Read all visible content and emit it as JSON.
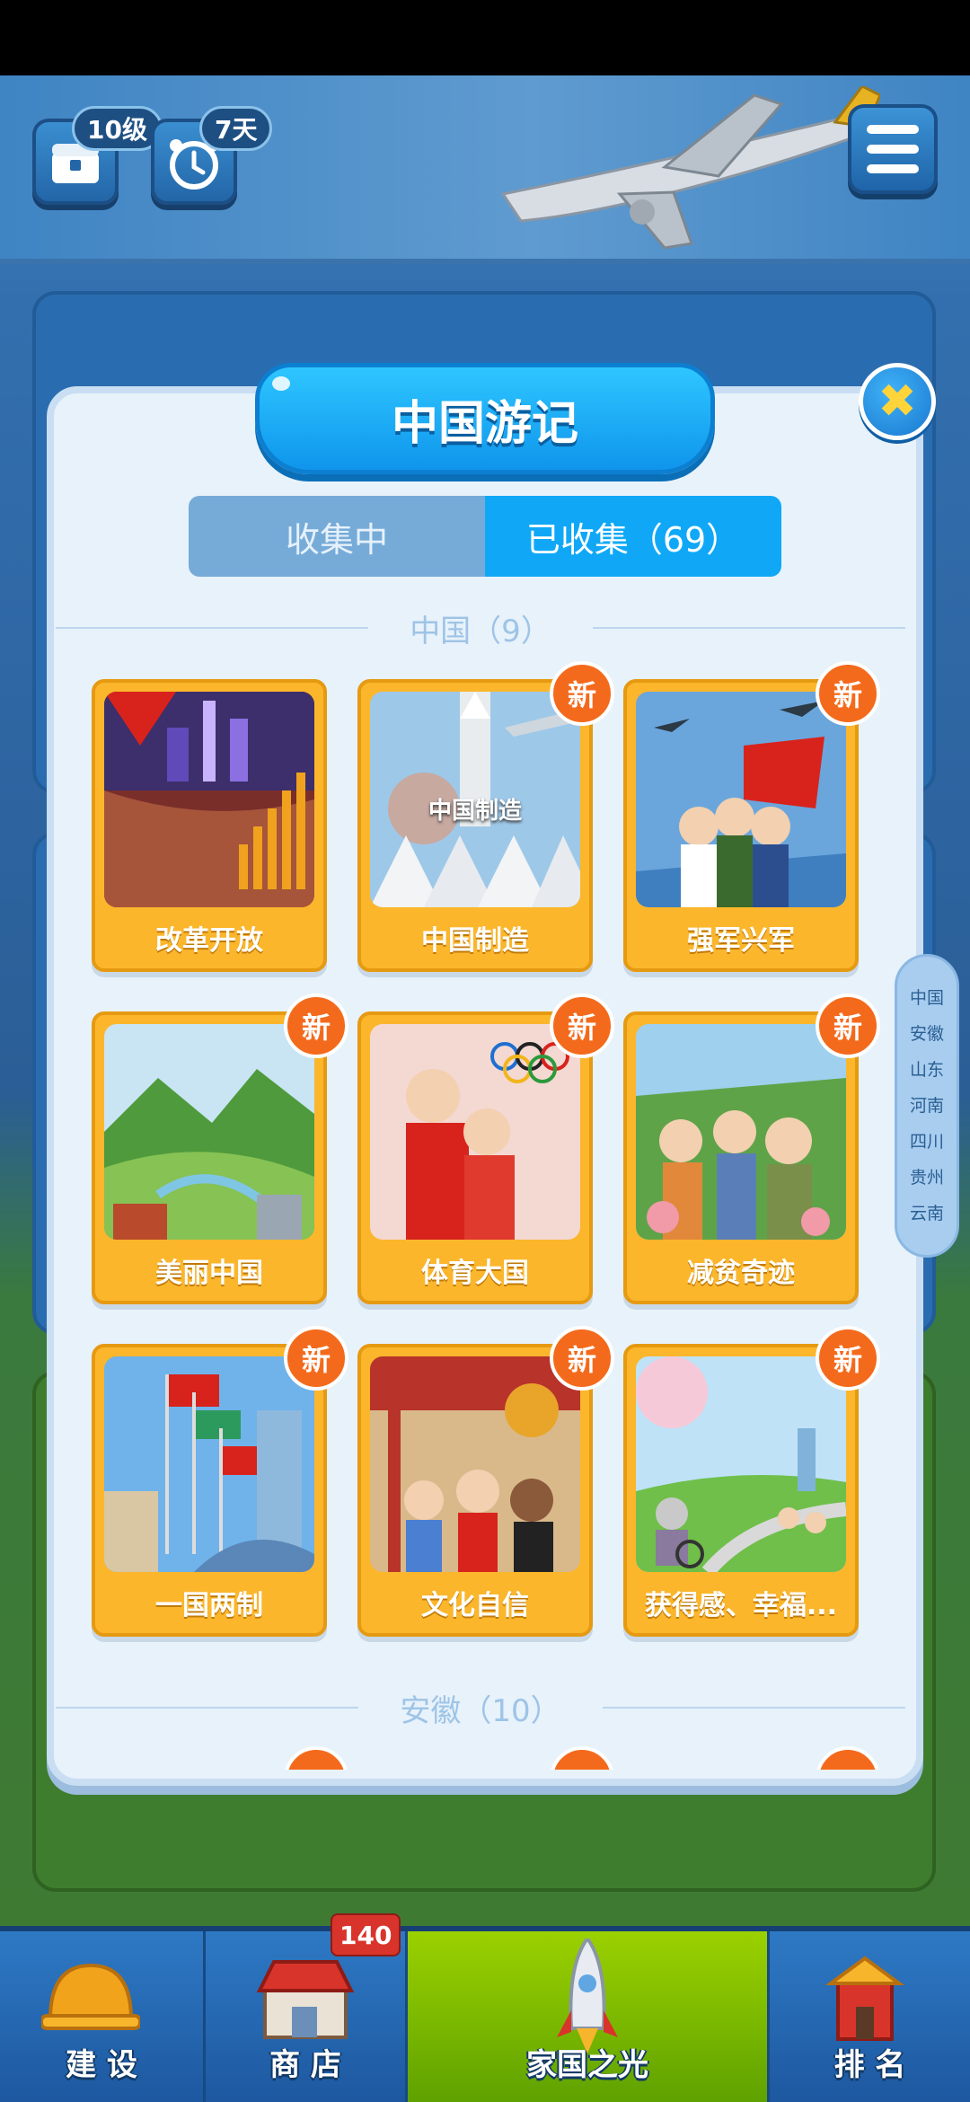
{
  "hud": {
    "level_badge": "10级",
    "days_badge": "7天"
  },
  "modal": {
    "title": "中国游记",
    "close_label": "✖",
    "tabs": [
      {
        "label": "收集中",
        "active": false
      },
      {
        "label": "已收集（69）",
        "active": true
      }
    ],
    "sections": [
      {
        "header": "中国（9）",
        "cards": [
          {
            "label": "改革开放",
            "new": false,
            "image": "reform-opening-image"
          },
          {
            "label": "中国制造",
            "new": true,
            "image": "made-in-china-image",
            "image_text": "中国制造"
          },
          {
            "label": "强军兴军",
            "new": true,
            "image": "strong-military-image"
          },
          {
            "label": "美丽中国",
            "new": true,
            "image": "beautiful-china-image"
          },
          {
            "label": "体育大国",
            "new": true,
            "image": "sports-power-image"
          },
          {
            "label": "减贫奇迹",
            "new": true,
            "image": "poverty-reduction-image"
          },
          {
            "label": "一国两制",
            "new": true,
            "image": "one-country-two-systems-image"
          },
          {
            "label": "文化自信",
            "new": true,
            "image": "cultural-confidence-image"
          },
          {
            "label": "获得感、幸福...",
            "new": true,
            "image": "happiness-image"
          }
        ]
      },
      {
        "header": "安徽（10）",
        "cards": []
      }
    ],
    "new_badge_label": "新"
  },
  "side_index": [
    "中国",
    "安徽",
    "山东",
    "河南",
    "四川",
    "贵州",
    "云南"
  ],
  "bottom_nav": {
    "items": [
      {
        "label": "建 设",
        "icon": "helmet-icon",
        "active": false
      },
      {
        "label": "商 店",
        "icon": "shop-icon",
        "active": false,
        "badge": "140"
      },
      {
        "label": "家国之光",
        "icon": "rocket-icon",
        "active": true
      },
      {
        "label": "排 名",
        "icon": "building-icon",
        "active": false
      }
    ]
  },
  "colors": {
    "card_gold": "#fbb62c",
    "new_badge": "#f46a1c",
    "tab_active": "#10a8f6",
    "banner_blue": "#1aa8f6"
  }
}
